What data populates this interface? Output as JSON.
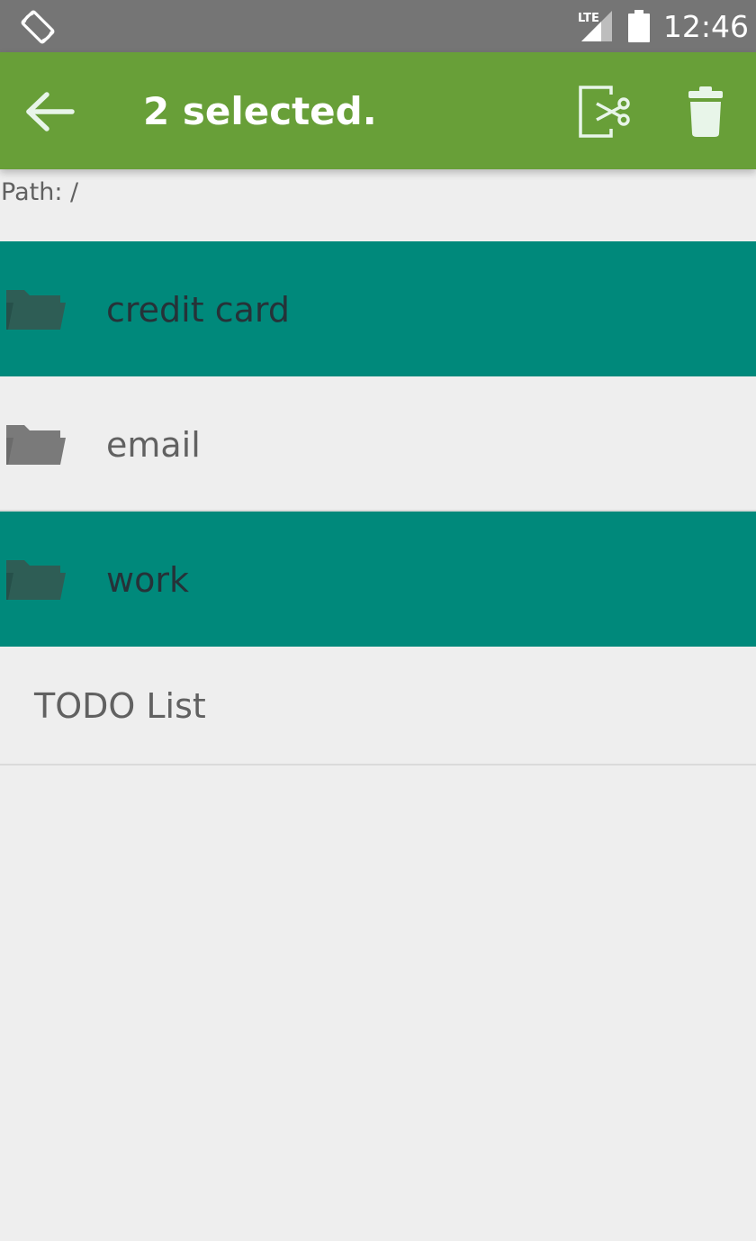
{
  "status_bar": {
    "time": "12:46",
    "network_label": "LTE",
    "icons": [
      "screen-rotation-icon",
      "lte-signal-icon",
      "battery-icon"
    ]
  },
  "app_bar": {
    "title": "2 selected.",
    "back_icon": "arrow-back-icon",
    "actions": [
      "cut-icon",
      "delete-icon"
    ],
    "color": "#689f38"
  },
  "path": {
    "label": "Path: /"
  },
  "items": [
    {
      "label": "credit card",
      "type": "folder",
      "selected": true
    },
    {
      "label": "email",
      "type": "folder",
      "selected": false
    },
    {
      "label": "work",
      "type": "folder",
      "selected": true
    },
    {
      "label": "TODO List",
      "type": "file",
      "selected": false
    }
  ],
  "colors": {
    "selected_row": "#00897b",
    "background": "#eeeeee",
    "status_bar": "#757575"
  }
}
